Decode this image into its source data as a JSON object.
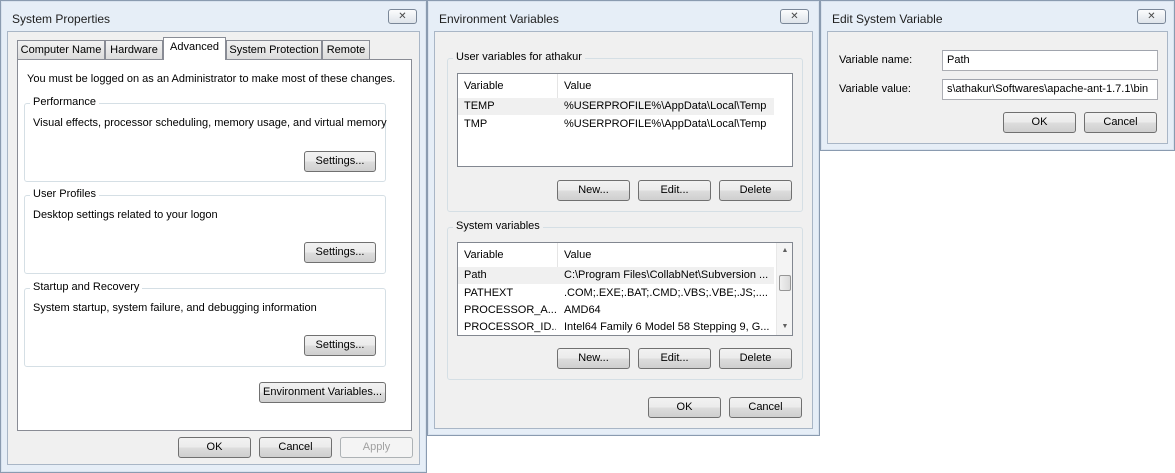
{
  "system_properties": {
    "title": "System Properties",
    "close_glyph": "✕",
    "tabs": [
      {
        "label": "Computer Name"
      },
      {
        "label": "Hardware"
      },
      {
        "label": "Advanced"
      },
      {
        "label": "System Protection"
      },
      {
        "label": "Remote"
      }
    ],
    "active_tab": "Advanced",
    "admin_note": "You must be logged on as an Administrator to make most of these changes.",
    "performance": {
      "label": "Performance",
      "description": "Visual effects, processor scheduling, memory usage, and virtual memory",
      "settings_button": "Settings..."
    },
    "user_profiles": {
      "label": "User Profiles",
      "description": "Desktop settings related to your logon",
      "settings_button": "Settings..."
    },
    "startup_recovery": {
      "label": "Startup and Recovery",
      "description": "System startup, system failure, and debugging information",
      "settings_button": "Settings..."
    },
    "env_vars_button": "Environment Variables...",
    "ok_button": "OK",
    "cancel_button": "Cancel",
    "apply_button": "Apply"
  },
  "environment_variables": {
    "title": "Environment Variables",
    "close_glyph": "✕",
    "user_section": {
      "label": "User variables for athakur",
      "columns": [
        "Variable",
        "Value"
      ],
      "rows": [
        {
          "variable": "TEMP",
          "value": "%USERPROFILE%\\AppData\\Local\\Temp"
        },
        {
          "variable": "TMP",
          "value": "%USERPROFILE%\\AppData\\Local\\Temp"
        }
      ],
      "new_button": "New...",
      "edit_button": "Edit...",
      "delete_button": "Delete"
    },
    "system_section": {
      "label": "System variables",
      "columns": [
        "Variable",
        "Value"
      ],
      "rows": [
        {
          "variable": "Path",
          "value": "C:\\Program Files\\CollabNet\\Subversion ..."
        },
        {
          "variable": "PATHEXT",
          "value": ".COM;.EXE;.BAT;.CMD;.VBS;.VBE;.JS;...."
        },
        {
          "variable": "PROCESSOR_A...",
          "value": "AMD64"
        },
        {
          "variable": "PROCESSOR_ID...",
          "value": "Intel64 Family 6 Model 58 Stepping 9, G..."
        }
      ],
      "new_button": "New...",
      "edit_button": "Edit...",
      "delete_button": "Delete"
    },
    "ok_button": "OK",
    "cancel_button": "Cancel"
  },
  "edit_system_variable": {
    "title": "Edit System Variable",
    "close_glyph": "✕",
    "name_label": "Variable name:",
    "name_value": "Path",
    "value_label": "Variable value:",
    "value_value": "s\\athakur\\Softwares\\apache-ant-1.7.1\\bin",
    "ok_button": "OK",
    "cancel_button": "Cancel"
  }
}
